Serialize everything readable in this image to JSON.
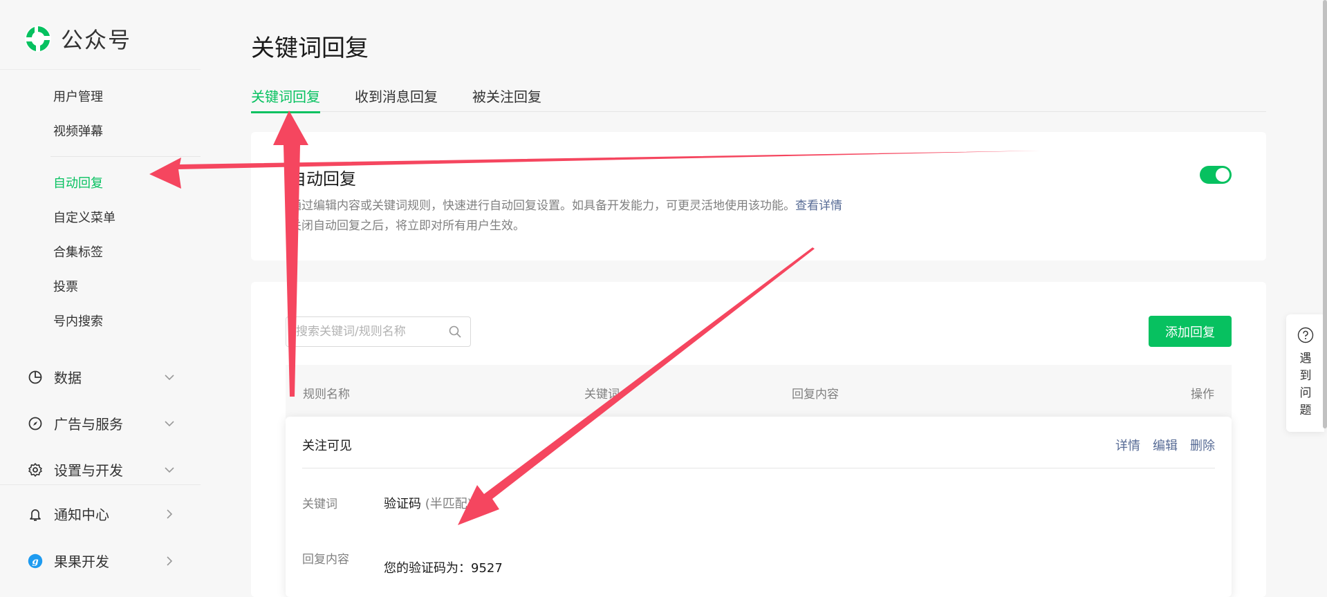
{
  "brand": {
    "name": "公众号"
  },
  "sidebar": {
    "sub_items": [
      {
        "label": "用户管理"
      },
      {
        "label": "视频弹幕"
      },
      {
        "label": "自动回复",
        "active": true
      },
      {
        "label": "自定义菜单"
      },
      {
        "label": "合集标签"
      },
      {
        "label": "投票"
      },
      {
        "label": "号内搜索"
      }
    ],
    "groups": [
      {
        "label": "数据",
        "icon": "pie-chart-icon"
      },
      {
        "label": "广告与服务",
        "icon": "compass-icon"
      },
      {
        "label": "设置与开发",
        "icon": "gear-icon"
      },
      {
        "label": "通知中心",
        "icon": "bell-icon"
      },
      {
        "label": "果果开发",
        "icon": "app-logo-icon"
      }
    ]
  },
  "page": {
    "title": "关键词回复"
  },
  "tabs": [
    {
      "label": "关键词回复",
      "active": true
    },
    {
      "label": "收到消息回复"
    },
    {
      "label": "被关注回复"
    }
  ],
  "auto_reply": {
    "title": "自动回复",
    "desc1": "通过编辑内容或关键词规则，快速进行自动回复设置。如具备开发能力，可更灵活地使用该功能。",
    "link": "查看详情",
    "desc2": "关闭自动回复之后，将立即对所有用户生效。",
    "enabled": true
  },
  "search": {
    "placeholder": "搜索关键词/规则名称"
  },
  "add_button": "添加回复",
  "table": {
    "headers": {
      "rule_name": "规则名称",
      "keyword": "关键词",
      "reply": "回复内容",
      "action": "操作"
    }
  },
  "rule": {
    "name": "关注可见",
    "ops": [
      "详情",
      "编辑",
      "删除"
    ],
    "keyword_label": "关键词",
    "keyword_value": "验证码",
    "keyword_match": "(半匹配)",
    "reply_label": "回复内容",
    "reply_value": "您的验证码为：9527"
  },
  "help": {
    "label": "遇到问题"
  },
  "colors": {
    "accent": "#07c160",
    "link": "#576b95",
    "arrow": "#f5465f"
  }
}
